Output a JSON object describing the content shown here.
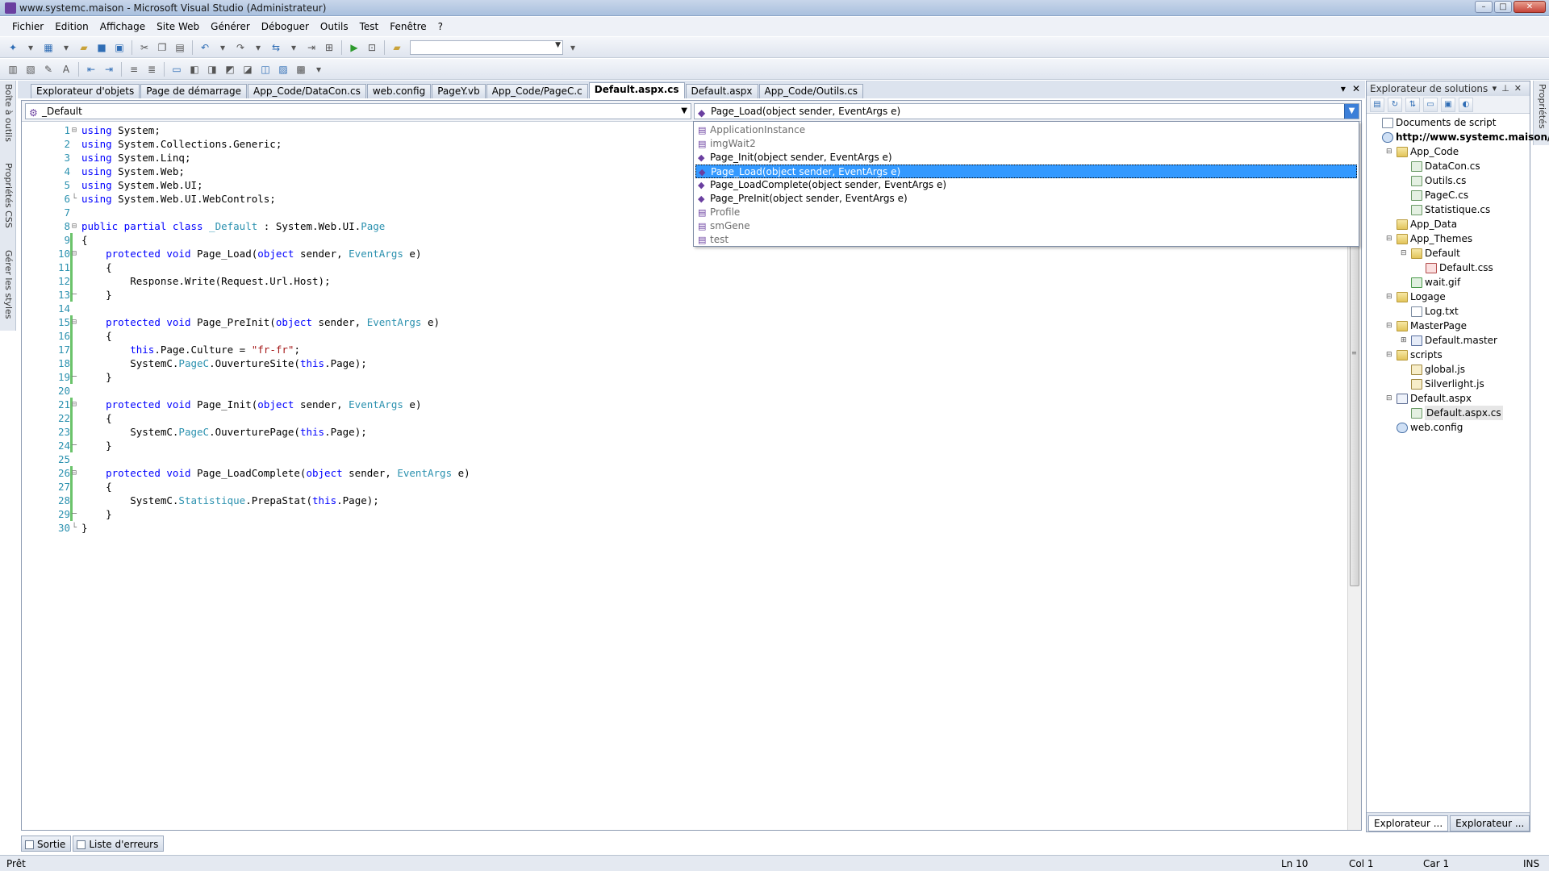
{
  "window": {
    "title": "www.systemc.maison - Microsoft Visual Studio (Administrateur)",
    "buttons": [
      "–",
      "□",
      "✕"
    ]
  },
  "menu": [
    "Fichier",
    "Edition",
    "Affichage",
    "Site Web",
    "Générer",
    "Déboguer",
    "Outils",
    "Test",
    "Fenêtre",
    "?"
  ],
  "left_tool_tabs": [
    "Boîte à outils",
    "Propriétés CSS",
    "Gérer les styles"
  ],
  "right_tool_tabs": [
    "Propriétés"
  ],
  "doc_tabs": [
    {
      "label": "Explorateur d'objets",
      "active": false
    },
    {
      "label": "Page de démarrage",
      "active": false
    },
    {
      "label": "App_Code/DataCon.cs",
      "active": false
    },
    {
      "label": "web.config",
      "active": false
    },
    {
      "label": "PageY.vb",
      "active": false
    },
    {
      "label": "App_Code/PageC.c",
      "active": false
    },
    {
      "label": "Default.aspx.cs",
      "active": true
    },
    {
      "label": "Default.aspx",
      "active": false
    },
    {
      "label": "App_Code/Outils.cs",
      "active": false
    }
  ],
  "navbar": {
    "class_combo": "_Default",
    "member_combo": "Page_Load(object sender, EventArgs e)"
  },
  "member_dropdown": [
    {
      "label": "ApplicationInstance",
      "gray": true,
      "selected": false
    },
    {
      "label": "imgWait2",
      "gray": true,
      "selected": false
    },
    {
      "label": "Page_Init(object sender, EventArgs e)",
      "gray": false,
      "selected": false
    },
    {
      "label": "Page_Load(object sender, EventArgs e)",
      "gray": false,
      "selected": true
    },
    {
      "label": "Page_LoadComplete(object sender, EventArgs e)",
      "gray": false,
      "selected": false
    },
    {
      "label": "Page_PreInit(object sender, EventArgs e)",
      "gray": false,
      "selected": false
    },
    {
      "label": "Profile",
      "gray": true,
      "selected": false
    },
    {
      "label": "smGene",
      "gray": true,
      "selected": false
    },
    {
      "label": "test",
      "gray": true,
      "selected": false
    }
  ],
  "code_lines": [
    [
      {
        "t": "using",
        "c": "kw"
      },
      {
        "t": " System;"
      }
    ],
    [
      {
        "t": "using",
        "c": "kw"
      },
      {
        "t": " System.Collections.Generic;"
      }
    ],
    [
      {
        "t": "using",
        "c": "kw"
      },
      {
        "t": " System.Linq;"
      }
    ],
    [
      {
        "t": "using",
        "c": "kw"
      },
      {
        "t": " System.Web;"
      }
    ],
    [
      {
        "t": "using",
        "c": "kw"
      },
      {
        "t": " System.Web.UI;"
      }
    ],
    [
      {
        "t": "using",
        "c": "kw"
      },
      {
        "t": " System.Web.UI.WebControls;"
      }
    ],
    [],
    [
      {
        "t": "public partial class",
        "c": "kw"
      },
      {
        "t": " "
      },
      {
        "t": "_Default",
        "c": "ty"
      },
      {
        "t": " : System.Web.UI."
      },
      {
        "t": "Page",
        "c": "ty"
      }
    ],
    [
      {
        "t": "{"
      }
    ],
    [
      {
        "t": "    "
      },
      {
        "t": "protected void",
        "c": "kw"
      },
      {
        "t": " Page_Load("
      },
      {
        "t": "object",
        "c": "kw"
      },
      {
        "t": " sender, "
      },
      {
        "t": "EventArgs",
        "c": "ty"
      },
      {
        "t": " e)"
      }
    ],
    [
      {
        "t": "    {"
      }
    ],
    [
      {
        "t": "        Response.Write(Request.Url.Host);"
      }
    ],
    [
      {
        "t": "    }"
      }
    ],
    [],
    [
      {
        "t": "    "
      },
      {
        "t": "protected void",
        "c": "kw"
      },
      {
        "t": " Page_PreInit("
      },
      {
        "t": "object",
        "c": "kw"
      },
      {
        "t": " sender, "
      },
      {
        "t": "EventArgs",
        "c": "ty"
      },
      {
        "t": " e)"
      }
    ],
    [
      {
        "t": "    {"
      }
    ],
    [
      {
        "t": "        "
      },
      {
        "t": "this",
        "c": "kw"
      },
      {
        "t": ".Page.Culture = "
      },
      {
        "t": "\"fr-fr\"",
        "c": "str"
      },
      {
        "t": ";"
      }
    ],
    [
      {
        "t": "        SystemC."
      },
      {
        "t": "PageC",
        "c": "ty"
      },
      {
        "t": ".OuvertureSite("
      },
      {
        "t": "this",
        "c": "kw"
      },
      {
        "t": ".Page);"
      }
    ],
    [
      {
        "t": "    }"
      }
    ],
    [],
    [
      {
        "t": "    "
      },
      {
        "t": "protected void",
        "c": "kw"
      },
      {
        "t": " Page_Init("
      },
      {
        "t": "object",
        "c": "kw"
      },
      {
        "t": " sender, "
      },
      {
        "t": "EventArgs",
        "c": "ty"
      },
      {
        "t": " e)"
      }
    ],
    [
      {
        "t": "    {"
      }
    ],
    [
      {
        "t": "        SystemC."
      },
      {
        "t": "PageC",
        "c": "ty"
      },
      {
        "t": ".OuverturePage("
      },
      {
        "t": "this",
        "c": "kw"
      },
      {
        "t": ".Page);"
      }
    ],
    [
      {
        "t": "    }"
      }
    ],
    [],
    [
      {
        "t": "    "
      },
      {
        "t": "protected void",
        "c": "kw"
      },
      {
        "t": " Page_LoadComplete("
      },
      {
        "t": "object",
        "c": "kw"
      },
      {
        "t": " sender, "
      },
      {
        "t": "EventArgs",
        "c": "ty"
      },
      {
        "t": " e)"
      }
    ],
    [
      {
        "t": "    {"
      }
    ],
    [
      {
        "t": "        SystemC."
      },
      {
        "t": "Statistique",
        "c": "ty"
      },
      {
        "t": ".PrepaStat("
      },
      {
        "t": "this",
        "c": "kw"
      },
      {
        "t": ".Page);"
      }
    ],
    [
      {
        "t": "    }"
      }
    ],
    [
      {
        "t": "}"
      }
    ]
  ],
  "fold_markers": {
    "1": "⊟",
    "6": "└",
    "8": "⊟",
    "10": "⊟",
    "13": "─",
    "15": "⊟",
    "19": "─",
    "21": "⊟",
    "24": "─",
    "26": "⊟",
    "29": "─",
    "30": "└"
  },
  "solution_explorer": {
    "title": "Explorateur de solutions",
    "nodes": [
      {
        "label": "Documents de script",
        "level": 0,
        "icon": "doc",
        "exp": "",
        "bold": false
      },
      {
        "label": "http://www.systemc.maison/",
        "level": 0,
        "icon": "web",
        "exp": "",
        "bold": true
      },
      {
        "label": "App_Code",
        "level": 1,
        "icon": "folder",
        "exp": "⊟",
        "bold": false
      },
      {
        "label": "DataCon.cs",
        "level": 2,
        "icon": "csfile",
        "exp": "",
        "bold": false
      },
      {
        "label": "Outils.cs",
        "level": 2,
        "icon": "csfile",
        "exp": "",
        "bold": false
      },
      {
        "label": "PageC.cs",
        "level": 2,
        "icon": "csfile",
        "exp": "",
        "bold": false
      },
      {
        "label": "Statistique.cs",
        "level": 2,
        "icon": "csfile",
        "exp": "",
        "bold": false
      },
      {
        "label": "App_Data",
        "level": 1,
        "icon": "folder",
        "exp": "",
        "bold": false
      },
      {
        "label": "App_Themes",
        "level": 1,
        "icon": "folder",
        "exp": "⊟",
        "bold": false
      },
      {
        "label": "Default",
        "level": 2,
        "icon": "folder",
        "exp": "⊟",
        "bold": false
      },
      {
        "label": "Default.css",
        "level": 3,
        "icon": "cssfile",
        "exp": "",
        "bold": false
      },
      {
        "label": "wait.gif",
        "level": 2,
        "icon": "giffile",
        "exp": "",
        "bold": false
      },
      {
        "label": "Logage",
        "level": 1,
        "icon": "folder",
        "exp": "⊟",
        "bold": false
      },
      {
        "label": "Log.txt",
        "level": 2,
        "icon": "doc",
        "exp": "",
        "bold": false
      },
      {
        "label": "MasterPage",
        "level": 1,
        "icon": "folder",
        "exp": "⊟",
        "bold": false
      },
      {
        "label": "Default.master",
        "level": 2,
        "icon": "master",
        "exp": "⊞",
        "bold": false
      },
      {
        "label": "scripts",
        "level": 1,
        "icon": "folder",
        "exp": "⊟",
        "bold": false
      },
      {
        "label": "global.js",
        "level": 2,
        "icon": "jsfile",
        "exp": "",
        "bold": false
      },
      {
        "label": "Silverlight.js",
        "level": 2,
        "icon": "jsfile",
        "exp": "",
        "bold": false
      },
      {
        "label": "Default.aspx",
        "level": 1,
        "icon": "aspx",
        "exp": "⊟",
        "bold": false
      },
      {
        "label": "Default.aspx.cs",
        "level": 2,
        "icon": "csfile",
        "exp": "",
        "bold": false,
        "selected": true
      },
      {
        "label": "web.config",
        "level": 1,
        "icon": "web",
        "exp": "",
        "bold": false
      }
    ],
    "bottom_tabs": [
      {
        "label": "Explorateur ...",
        "active": true
      },
      {
        "label": "Explorateur ...",
        "active": false
      }
    ]
  },
  "bottom_tabs": [
    "Sortie",
    "Liste d'erreurs"
  ],
  "status": {
    "text": "Prêt",
    "line": "Ln 10",
    "col": "Col 1",
    "car": "Car 1",
    "mode": "INS"
  }
}
